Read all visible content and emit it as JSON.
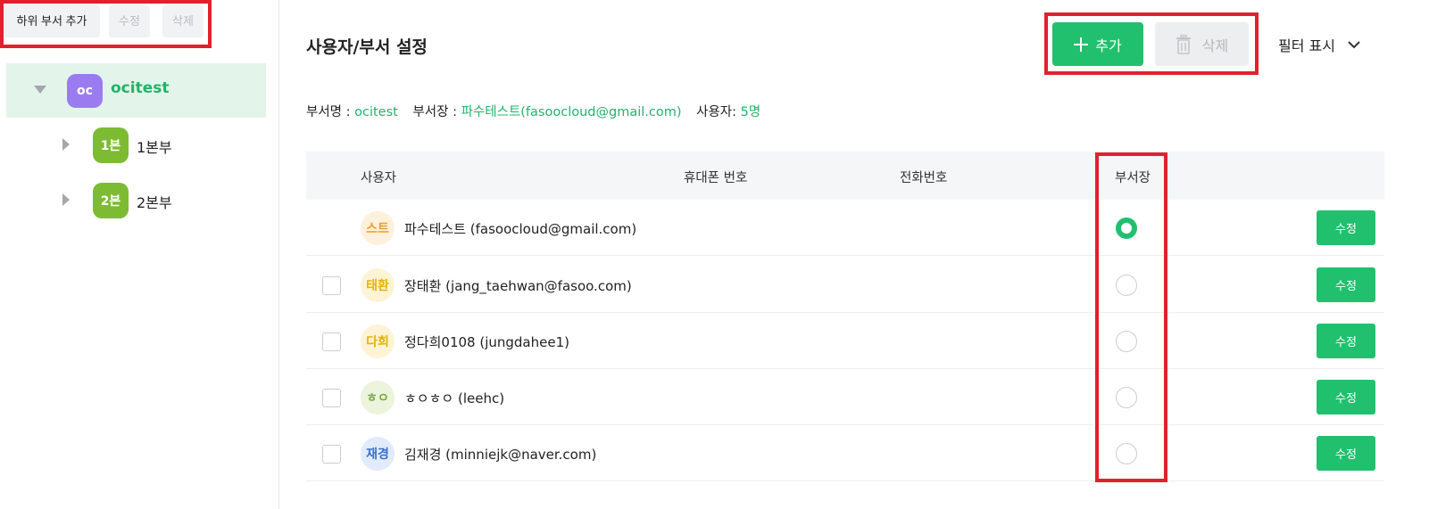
{
  "tree_toolbar": {
    "add_sub": "하위 부서 추가",
    "edit": "수정",
    "delete": "삭제"
  },
  "tree": {
    "root": {
      "badge": "oc",
      "label": "ocitest"
    },
    "children": [
      {
        "badge": "1본",
        "label": "1본부"
      },
      {
        "badge": "2본",
        "label": "2본부"
      }
    ]
  },
  "header": {
    "title": "사용자/부서 설정",
    "add_label": "추가",
    "delete_label": "삭제",
    "filter_label": "필터 표시"
  },
  "info": {
    "dept_name_label": "부서명 :",
    "dept_name": "ocitest",
    "head_label": "부서장 :",
    "head_value": "파수테스트(fasoocloud@gmail.com)",
    "users_label": "사용자:",
    "users_value": "5명"
  },
  "table": {
    "columns": {
      "user": "사용자",
      "mobile": "휴대폰 번호",
      "phone": "전화번호",
      "head": "부서장"
    },
    "edit_label": "수정",
    "rows": [
      {
        "avatar": "스트",
        "avatar_bg": "#fdf1dc",
        "avatar_fg": "#f0a02a",
        "name": "파수테스트 (fasoocloud@gmail.com)",
        "is_head": true,
        "checkbox": false
      },
      {
        "avatar": "태환",
        "avatar_bg": "#fdf4d6",
        "avatar_fg": "#e6b400",
        "name": "장태환 (jang_taehwan@fasoo.com)",
        "is_head": false,
        "checkbox": true
      },
      {
        "avatar": "다희",
        "avatar_bg": "#fdf4d6",
        "avatar_fg": "#e6b400",
        "name": "정다희0108 (jungdahee1)",
        "is_head": false,
        "checkbox": true
      },
      {
        "avatar": "ㅎㅇ",
        "avatar_bg": "#ecf4dc",
        "avatar_fg": "#7aa83a",
        "name": "ㅎㅇㅎㅇ (leehc)",
        "is_head": false,
        "checkbox": true
      },
      {
        "avatar": "재경",
        "avatar_bg": "#e1ebfb",
        "avatar_fg": "#3a6fd0",
        "name": "김재경 (minniejk@naver.com)",
        "is_head": false,
        "checkbox": true
      }
    ]
  },
  "colors": {
    "accent": "#21c06e",
    "highlight": "#e0212e",
    "root_badge": "#9b7cf0",
    "child_badge": "#7dbb33"
  }
}
